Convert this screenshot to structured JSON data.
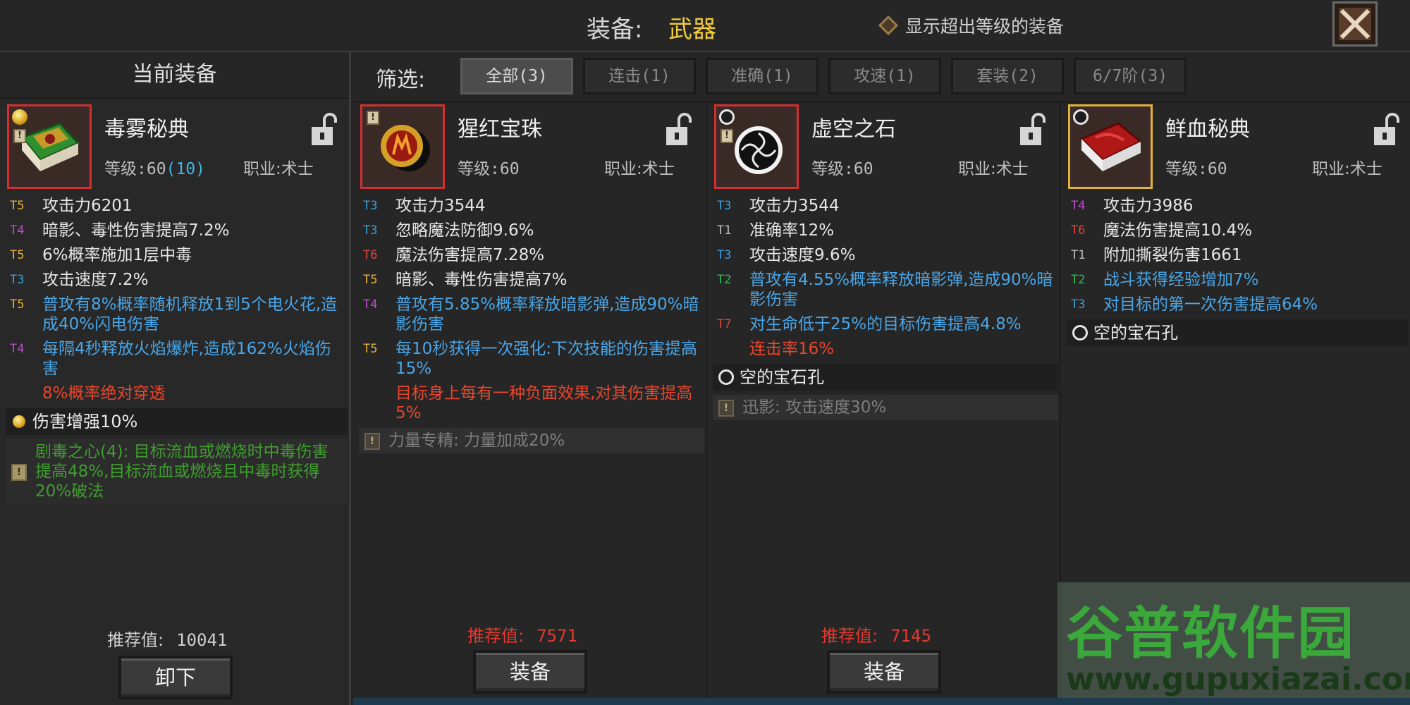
{
  "header": {
    "title_label": "装备:",
    "title_value": "武器",
    "show_higher_label": "显示超出等级的装备"
  },
  "left": {
    "title": "当前装备",
    "item": {
      "name": "毒雾秘典",
      "level_label": "等级:60",
      "level_extra": "(10)",
      "class_label": "职业:术士",
      "stats": [
        {
          "tier": "T5",
          "text": "攻击力6201",
          "color": "plain"
        },
        {
          "tier": "T4",
          "text": "暗影、毒性伤害提高7.2%",
          "color": "plain"
        },
        {
          "tier": "T5",
          "text": "6%概率施加1层中毒",
          "color": "plain"
        },
        {
          "tier": "T3",
          "text": "攻击速度7.2%",
          "color": "plain"
        },
        {
          "tier": "T5",
          "text": "普攻有8%概率随机释放1到5个电火花,造成40%闪电伤害",
          "color": "blue"
        },
        {
          "tier": "T4",
          "text": "每隔4秒释放火焰爆炸,造成162%火焰伤害",
          "color": "blue"
        },
        {
          "tier": "",
          "text": "8%概率绝对穿透",
          "color": "red"
        }
      ],
      "gem_slot": "伤害增强10%",
      "set_bonus": "剧毒之心(4): 目标流血或燃烧时中毒伤害提高48%,目标流血或燃烧且中毒时获得20%破法"
    },
    "rec_label": "推荐值:",
    "rec_value": "10041",
    "button": "卸下"
  },
  "filter": {
    "label": "筛选:",
    "tabs": [
      "全部(3)",
      "连击(1)",
      "准确(1)",
      "攻速(1)",
      "套装(2)",
      "6/7阶(3)"
    ]
  },
  "items": [
    {
      "name": "猩红宝珠",
      "level_label": "等级:60",
      "class_label": "职业:术士",
      "stats": [
        {
          "tier": "T3",
          "text": "攻击力3544",
          "color": "plain"
        },
        {
          "tier": "T3",
          "text": "忽略魔法防御9.6%",
          "color": "plain"
        },
        {
          "tier": "T6",
          "text": "魔法伤害提高7.28%",
          "color": "plain"
        },
        {
          "tier": "T5",
          "text": "暗影、毒性伤害提高7%",
          "color": "plain"
        },
        {
          "tier": "T4",
          "text": "普攻有5.85%概率释放暗影弹,造成90%暗影伤害",
          "color": "blue"
        },
        {
          "tier": "T5",
          "text": "每10秒获得一次强化:下次技能的伤害提高15%",
          "color": "blue"
        },
        {
          "tier": "",
          "text": "目标身上每有一种负面效果,对其伤害提高5%",
          "color": "red"
        }
      ],
      "gem_slot": "",
      "set_bonus": "力量专精: 力量加成20%",
      "rec_label": "推荐值:",
      "rec_value": "7571",
      "button": "装备"
    },
    {
      "name": "虚空之石",
      "level_label": "等级:60",
      "class_label": "职业:术士",
      "stats": [
        {
          "tier": "T3",
          "text": "攻击力3544",
          "color": "plain"
        },
        {
          "tier": "T1",
          "text": "准确率12%",
          "color": "plain"
        },
        {
          "tier": "T3",
          "text": "攻击速度9.6%",
          "color": "plain"
        },
        {
          "tier": "T2",
          "text": "普攻有4.55%概率释放暗影弹,造成90%暗影伤害",
          "color": "blue"
        },
        {
          "tier": "T7",
          "text": "对生命低于25%的目标伤害提高4.8%",
          "color": "blue"
        },
        {
          "tier": "",
          "text": "连击率16%",
          "color": "red"
        }
      ],
      "gem_slot": "空的宝石孔",
      "set_bonus": "迅影: 攻击速度30%",
      "rec_label": "推荐值:",
      "rec_value": "7145",
      "button": "装备"
    },
    {
      "name": "鲜血秘典",
      "level_label": "等级:60",
      "class_label": "职业:术士",
      "stats": [
        {
          "tier": "T4",
          "text": "攻击力3986",
          "color": "plain"
        },
        {
          "tier": "T6",
          "text": "魔法伤害提高10.4%",
          "color": "plain"
        },
        {
          "tier": "T1",
          "text": "附加撕裂伤害1661",
          "color": "plain"
        },
        {
          "tier": "T2",
          "text": "战斗获得经验增加7%",
          "color": "blue"
        },
        {
          "tier": "T3",
          "text": "对目标的第一次伤害提高64%",
          "color": "blue"
        }
      ],
      "gem_slot": "空的宝石孔",
      "set_bonus": "",
      "rec_label": "",
      "rec_value": "",
      "button": ""
    }
  ],
  "tier_colors": {
    "T1": "#bdbdbd",
    "T2": "#2fbf4f",
    "T3": "#3a9fe0",
    "T4": "#c04ad0",
    "T5": "#e8b030",
    "T6": "#e0463a",
    "T7": "#e0463a"
  },
  "watermark": {
    "text": "谷普软件园",
    "url": "www.gupuxiazai.com"
  }
}
